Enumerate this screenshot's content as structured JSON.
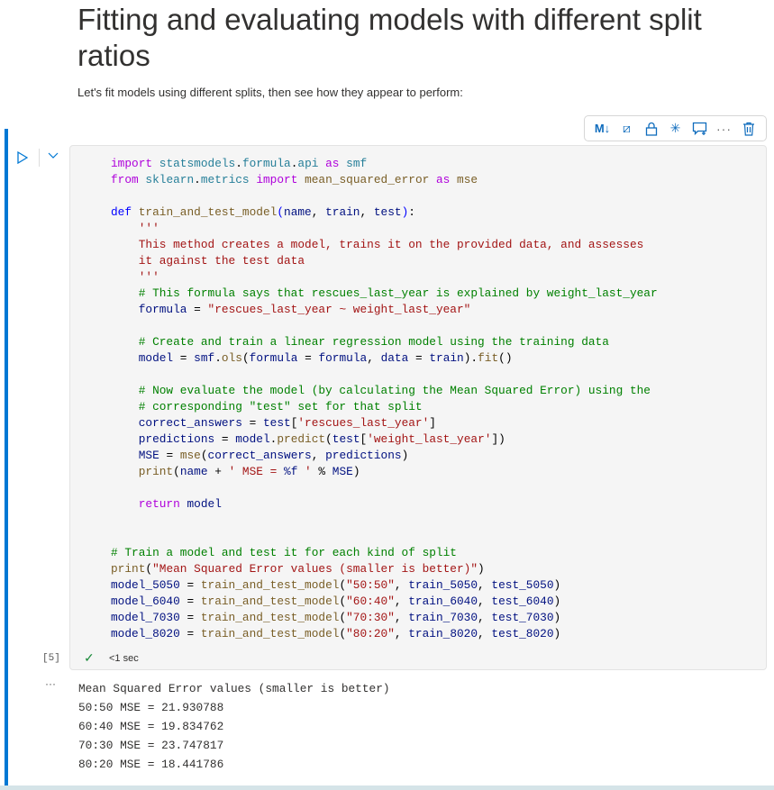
{
  "header": {
    "title": "Fitting and evaluating models with different split ratios",
    "paragraph": "Let's fit models using different splits, then see how they appear to perform:"
  },
  "toolbar": {
    "markdown": "M↓",
    "clear": "⧄",
    "lock": "🔒",
    "freeze": "✳",
    "comment": "🗨",
    "more": "···",
    "delete": "🗑"
  },
  "cell": {
    "execution_count": "[5]",
    "status": "<1 sec",
    "status_icon": "check-icon",
    "output_more": "···",
    "code": [
      [
        [
          "k",
          "import"
        ],
        [
          "p",
          " "
        ],
        [
          "m",
          "statsmodels"
        ],
        [
          "p",
          "."
        ],
        [
          "m",
          "formula"
        ],
        [
          "p",
          "."
        ],
        [
          "m",
          "api"
        ],
        [
          "p",
          " "
        ],
        [
          "k",
          "as"
        ],
        [
          "p",
          " "
        ],
        [
          "m",
          "smf"
        ]
      ],
      [
        [
          "k",
          "from"
        ],
        [
          "p",
          " "
        ],
        [
          "m",
          "sklearn"
        ],
        [
          "p",
          "."
        ],
        [
          "m",
          "metrics"
        ],
        [
          "p",
          " "
        ],
        [
          "k",
          "import"
        ],
        [
          "p",
          " "
        ],
        [
          "f",
          "mean_squared_error"
        ],
        [
          "p",
          " "
        ],
        [
          "k",
          "as"
        ],
        [
          "p",
          " "
        ],
        [
          "f",
          "mse"
        ]
      ],
      [],
      [
        [
          "d",
          "def"
        ],
        [
          "p",
          " "
        ],
        [
          "f",
          "train_and_test_model"
        ],
        [
          "d",
          "("
        ],
        [
          "v",
          "name"
        ],
        [
          "p",
          ", "
        ],
        [
          "v",
          "train"
        ],
        [
          "p",
          ", "
        ],
        [
          "v",
          "test"
        ],
        [
          "d",
          ")"
        ],
        [
          "p",
          ":"
        ]
      ],
      [
        [
          "s",
          "    '''"
        ]
      ],
      [
        [
          "s",
          "    This method creates a model, trains it on the provided data, and assesses"
        ]
      ],
      [
        [
          "s",
          "    it against the test data"
        ]
      ],
      [
        [
          "s",
          "    '''"
        ]
      ],
      [
        [
          "c",
          "    # This formula says that rescues_last_year is explained by weight_last_year"
        ]
      ],
      [
        [
          "v",
          "    formula"
        ],
        [
          "p",
          " = "
        ],
        [
          "s",
          "\"rescues_last_year ~ weight_last_year\""
        ]
      ],
      [],
      [
        [
          "c",
          "    # Create and train a linear regression model using the training data"
        ]
      ],
      [
        [
          "v",
          "    model"
        ],
        [
          "p",
          " = "
        ],
        [
          "v",
          "smf"
        ],
        [
          "p",
          "."
        ],
        [
          "f",
          "ols"
        ],
        [
          "p",
          "("
        ],
        [
          "v",
          "formula"
        ],
        [
          "p",
          " = "
        ],
        [
          "v",
          "formula"
        ],
        [
          "p",
          ", "
        ],
        [
          "v",
          "data"
        ],
        [
          "p",
          " = "
        ],
        [
          "v",
          "train"
        ],
        [
          "p",
          ")."
        ],
        [
          "f",
          "fit"
        ],
        [
          "p",
          "()"
        ]
      ],
      [],
      [
        [
          "c",
          "    # Now evaluate the model (by calculating the Mean Squared Error) using the"
        ]
      ],
      [
        [
          "c",
          "    # corresponding \"test\" set for that split"
        ]
      ],
      [
        [
          "v",
          "    correct_answers"
        ],
        [
          "p",
          " = "
        ],
        [
          "v",
          "test"
        ],
        [
          "p",
          "["
        ],
        [
          "s",
          "'rescues_last_year'"
        ],
        [
          "p",
          "]"
        ]
      ],
      [
        [
          "v",
          "    predictions"
        ],
        [
          "p",
          " = "
        ],
        [
          "v",
          "model"
        ],
        [
          "p",
          "."
        ],
        [
          "f",
          "predict"
        ],
        [
          "p",
          "("
        ],
        [
          "v",
          "test"
        ],
        [
          "p",
          "["
        ],
        [
          "s",
          "'weight_last_year'"
        ],
        [
          "p",
          "])"
        ]
      ],
      [
        [
          "v",
          "    MSE"
        ],
        [
          "p",
          " = "
        ],
        [
          "f",
          "mse"
        ],
        [
          "p",
          "("
        ],
        [
          "v",
          "correct_answers"
        ],
        [
          "p",
          ", "
        ],
        [
          "v",
          "predictions"
        ],
        [
          "p",
          ")"
        ]
      ],
      [
        [
          "f",
          "    print"
        ],
        [
          "p",
          "("
        ],
        [
          "v",
          "name"
        ],
        [
          "p",
          " + "
        ],
        [
          "s",
          "' MSE = "
        ],
        [
          "v",
          "%f"
        ],
        [
          "s",
          " '"
        ],
        [
          "p",
          " % "
        ],
        [
          "v",
          "MSE"
        ],
        [
          "p",
          ")"
        ]
      ],
      [],
      [
        [
          "k",
          "    return"
        ],
        [
          "p",
          " "
        ],
        [
          "v",
          "model"
        ]
      ],
      [],
      [],
      [
        [
          "c",
          "# Train a model and test it for each kind of split"
        ]
      ],
      [
        [
          "f",
          "print"
        ],
        [
          "p",
          "("
        ],
        [
          "s",
          "\"Mean Squared Error values (smaller is better)\""
        ],
        [
          "p",
          ")"
        ]
      ],
      [
        [
          "v",
          "model_5050"
        ],
        [
          "p",
          " = "
        ],
        [
          "f",
          "train_and_test_model"
        ],
        [
          "p",
          "("
        ],
        [
          "s",
          "\"50:50\""
        ],
        [
          "p",
          ", "
        ],
        [
          "v",
          "train_5050"
        ],
        [
          "p",
          ", "
        ],
        [
          "v",
          "test_5050"
        ],
        [
          "p",
          ")"
        ]
      ],
      [
        [
          "v",
          "model_6040"
        ],
        [
          "p",
          " = "
        ],
        [
          "f",
          "train_and_test_model"
        ],
        [
          "p",
          "("
        ],
        [
          "s",
          "\"60:40\""
        ],
        [
          "p",
          ", "
        ],
        [
          "v",
          "train_6040"
        ],
        [
          "p",
          ", "
        ],
        [
          "v",
          "test_6040"
        ],
        [
          "p",
          ")"
        ]
      ],
      [
        [
          "v",
          "model_7030"
        ],
        [
          "p",
          " = "
        ],
        [
          "f",
          "train_and_test_model"
        ],
        [
          "p",
          "("
        ],
        [
          "s",
          "\"70:30\""
        ],
        [
          "p",
          ", "
        ],
        [
          "v",
          "train_7030"
        ],
        [
          "p",
          ", "
        ],
        [
          "v",
          "test_7030"
        ],
        [
          "p",
          ")"
        ]
      ],
      [
        [
          "v",
          "model_8020"
        ],
        [
          "p",
          " = "
        ],
        [
          "f",
          "train_and_test_model"
        ],
        [
          "p",
          "("
        ],
        [
          "s",
          "\"80:20\""
        ],
        [
          "p",
          ", "
        ],
        [
          "v",
          "train_8020"
        ],
        [
          "p",
          ", "
        ],
        [
          "v",
          "test_8020"
        ],
        [
          "p",
          ")"
        ]
      ]
    ],
    "output": [
      "Mean Squared Error values (smaller is better)",
      "50:50 MSE = 21.930788",
      "60:40 MSE = 19.834762",
      "70:30 MSE = 23.747817",
      "80:20 MSE = 18.441786"
    ]
  }
}
